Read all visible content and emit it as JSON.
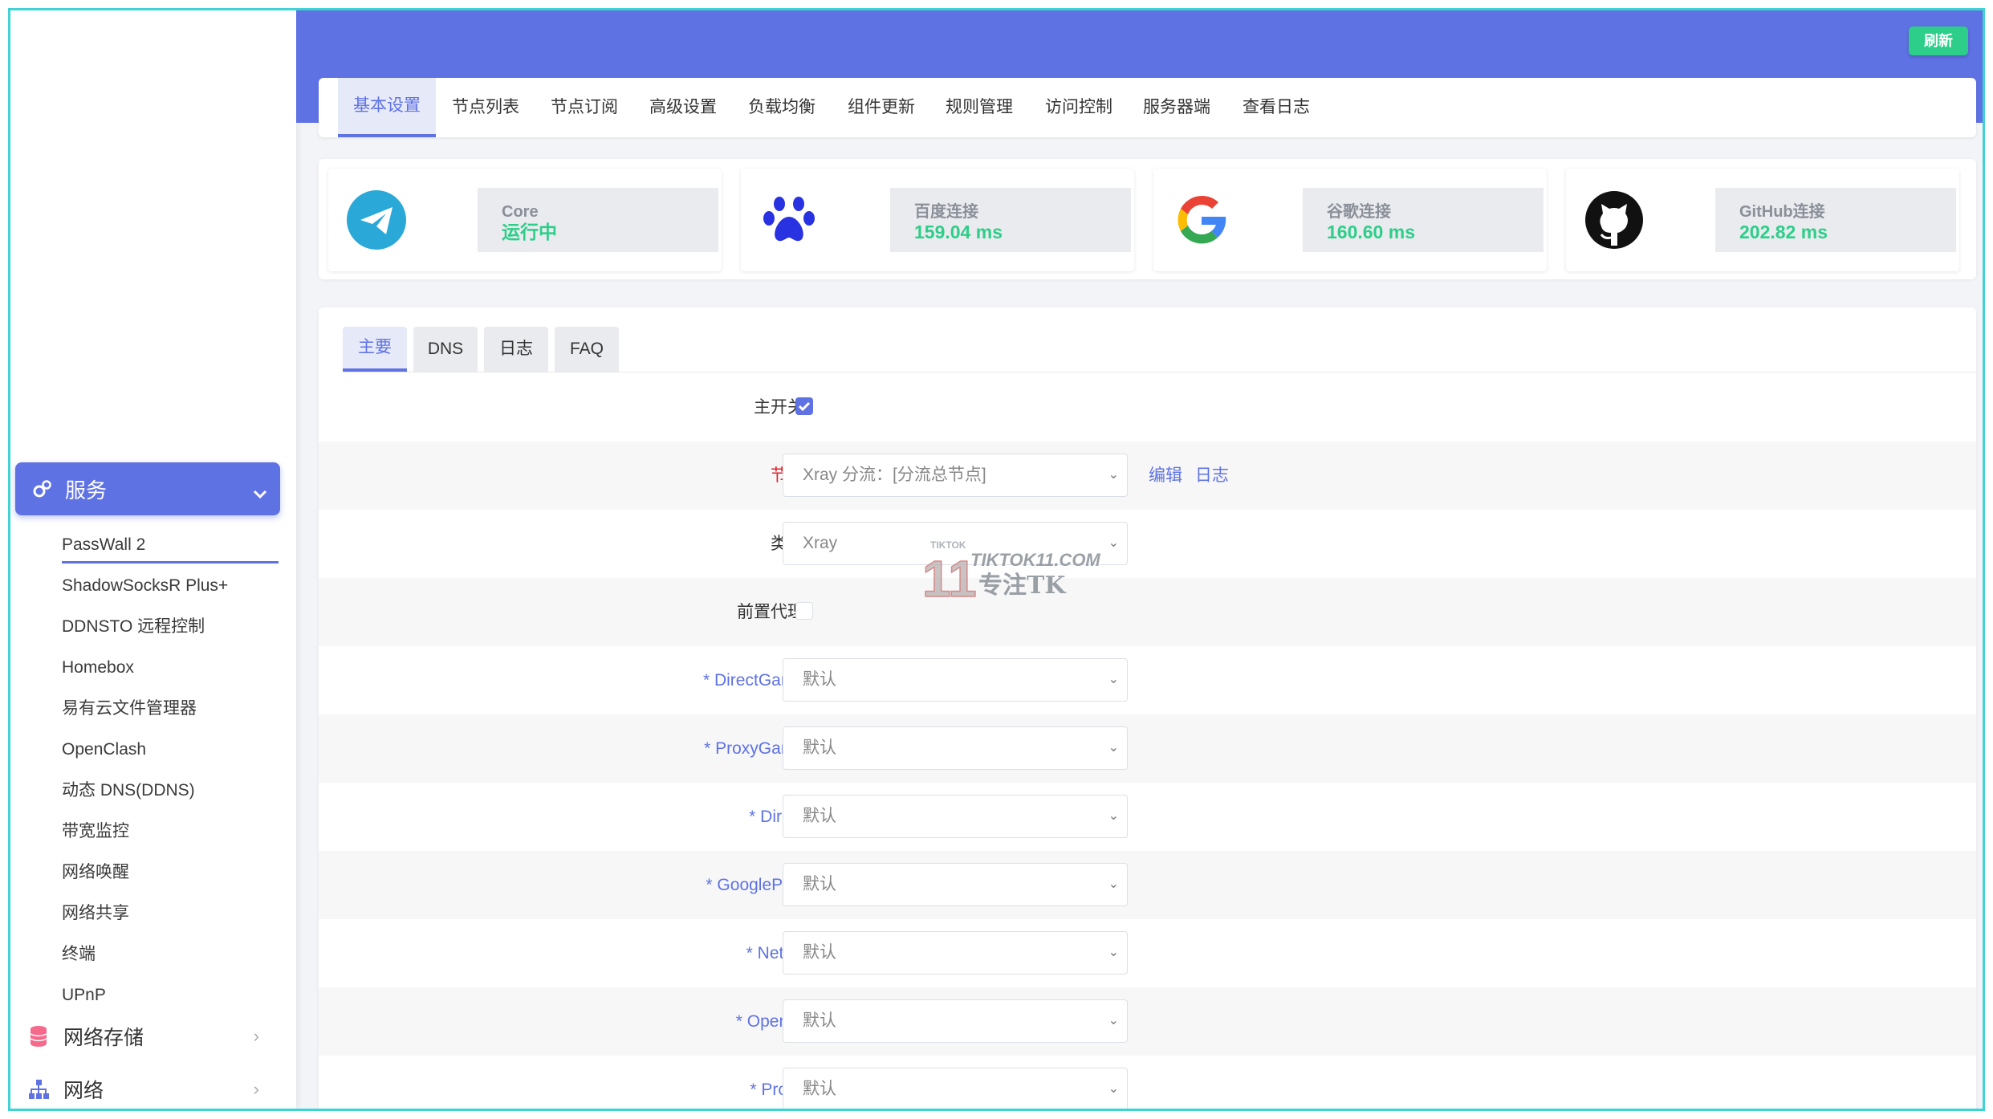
{
  "header": {
    "refresh_label": "刷新",
    "accent": "#5e72e4"
  },
  "top_tabs": [
    "基本设置",
    "节点列表",
    "节点订阅",
    "高级设置",
    "负载均衡",
    "组件更新",
    "规则管理",
    "访问控制",
    "服务器端",
    "查看日志"
  ],
  "status_cards": [
    {
      "icon": "telegram-icon",
      "label": "Core",
      "value": "运行中"
    },
    {
      "icon": "baidu-paw-icon",
      "label": "百度连接",
      "value": "159.04 ms"
    },
    {
      "icon": "google-icon",
      "label": "谷歌连接",
      "value": "160.60 ms"
    },
    {
      "icon": "github-icon",
      "label": "GitHub连接",
      "value": "202.82 ms"
    }
  ],
  "sidebar": {
    "section": "服务",
    "items": [
      "PassWall 2",
      "ShadowSocksR Plus+",
      "DDNSTO 远程控制",
      "Homebox",
      "易有云文件管理器",
      "OpenClash",
      "动态 DNS(DDNS)",
      "带宽监控",
      "网络唤醒",
      "网络共享",
      "终端",
      "UPnP"
    ],
    "categories": [
      "网络存储",
      "网络"
    ]
  },
  "sub_tabs": [
    "主要",
    "DNS",
    "日志",
    "FAQ"
  ],
  "form": {
    "main_switch": "主开关",
    "node_label": "节点",
    "node_value": "Xray 分流：[分流总节点]",
    "node_links": [
      "编辑",
      "日志"
    ],
    "type_label": "类型",
    "type_value": "Xray",
    "pre_proxy_label": "前置代理",
    "rules": [
      {
        "label": "* DirectGame",
        "value": "默认"
      },
      {
        "label": "* ProxyGame",
        "value": "默认"
      },
      {
        "label": "* Direct",
        "value": "默认"
      },
      {
        "label": "* GooglePlay",
        "value": "默认"
      },
      {
        "label": "* Netflix",
        "value": "默认"
      },
      {
        "label": "* OpenAI",
        "value": "默认"
      },
      {
        "label": "* Proxy",
        "value": "默认"
      }
    ]
  },
  "watermark": {
    "top": "TIKTOK",
    "site": "TIKTOK11.COM",
    "num": "11",
    "slogan": "专注TK"
  }
}
